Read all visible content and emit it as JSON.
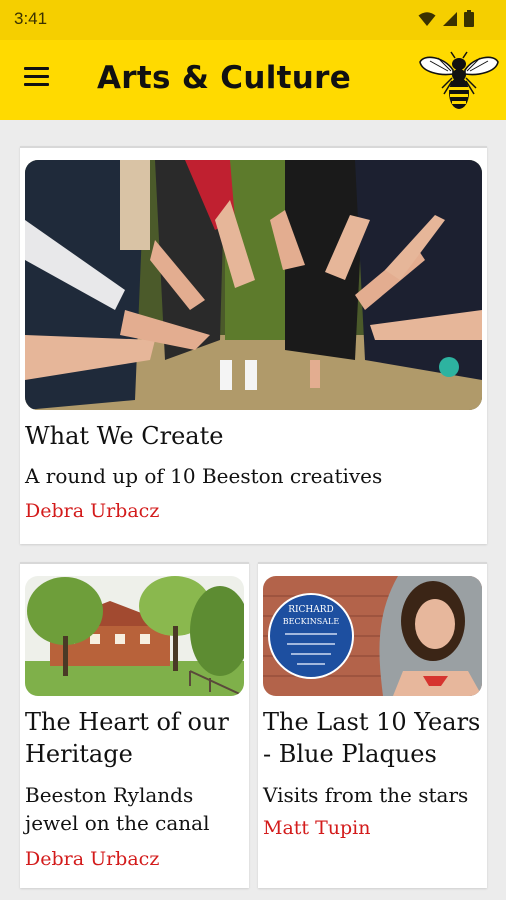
{
  "status_bar": {
    "time": "3:41"
  },
  "app_bar": {
    "title": "Arts & Culture"
  },
  "articles": [
    {
      "title": "What We Create",
      "subtitle": "A round up of 10 Beeston creatives",
      "author": "Debra Urbacz"
    },
    {
      "title": "The Heart of our Heritage",
      "subtitle": "Beeston Rylands jewel on the canal",
      "author": "Debra Urbacz"
    },
    {
      "title": "The Last 10 Years - Blue Plaques",
      "subtitle": "Visits from the stars",
      "author": "Matt Tupin"
    }
  ],
  "plaque": {
    "line1": "RICHARD",
    "line2": "BECKINSALE"
  },
  "colors": {
    "app_bar": "#ffda00",
    "status_bar": "#f5cf00",
    "author": "#d31b1b"
  }
}
